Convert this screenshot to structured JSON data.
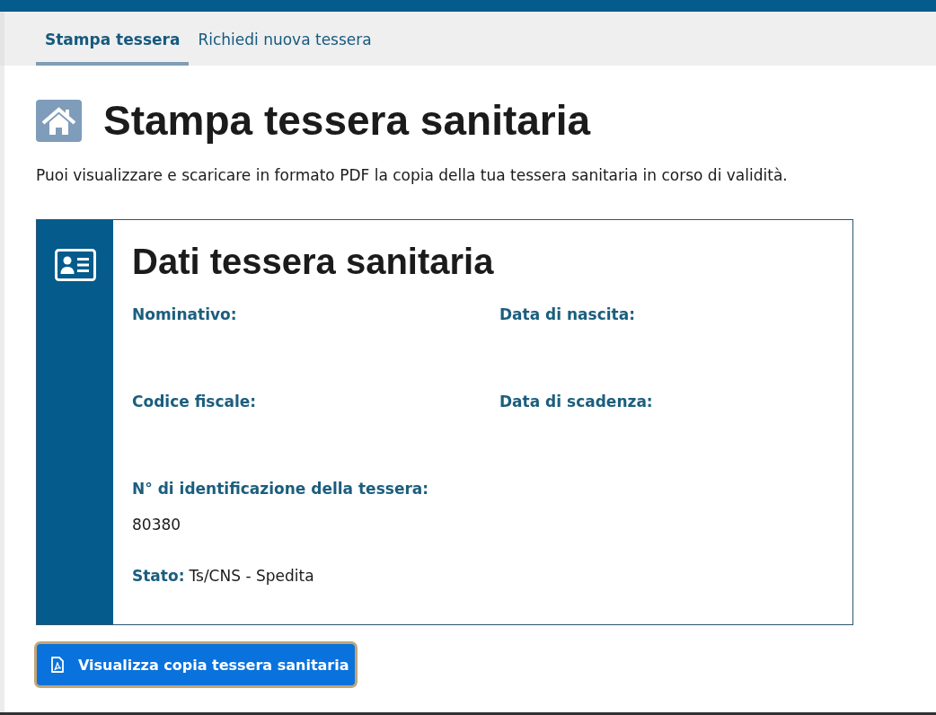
{
  "tabs": [
    {
      "label": "Stampa tessera",
      "selected": true
    },
    {
      "label": "Richiedi nuova tessera",
      "selected": false
    }
  ],
  "page": {
    "title": "Stampa tessera sanitaria",
    "description": "Puoi visualizzare e scaricare in formato PDF la copia della tua tessera sanitaria in corso di validità."
  },
  "card": {
    "title": "Dati tessera sanitaria",
    "fields": [
      {
        "label": "Nominativo:"
      },
      {
        "label": "Data di nascita:"
      },
      {
        "label": "Codice fiscale:"
      },
      {
        "label": "Data di scadenza:"
      },
      {
        "label": "N° di identificazione della tessera:",
        "value": "80380"
      }
    ],
    "status": {
      "label": "Stato:",
      "value": "Ts/CNS - Spedita"
    }
  },
  "button": {
    "label": "Visualizza copia tessera sanitaria",
    "focused": true
  }
}
